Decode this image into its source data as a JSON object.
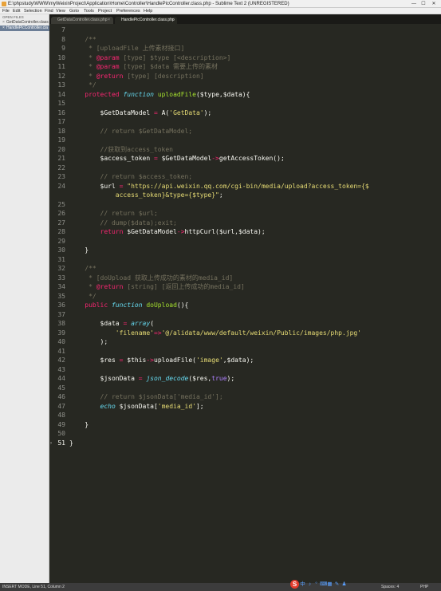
{
  "window": {
    "title": "E:\\phpstudy\\WWW\\myWeixinProject\\Application\\Home\\Controller\\HandlePicController.class.php - Sublime Text 2 (UNREGISTERED)",
    "minimize": "—",
    "maximize": "☐",
    "close": "✕"
  },
  "menu": [
    "File",
    "Edit",
    "Selection",
    "Find",
    "View",
    "Goto",
    "Tools",
    "Project",
    "Preferences",
    "Help"
  ],
  "sidebar": {
    "header": "OPEN FILES",
    "files": [
      {
        "name": "GetDataController.class",
        "active": false
      },
      {
        "name": "HandlePicController.cla",
        "active": true
      }
    ],
    "close_glyph": "×"
  },
  "tabs": [
    {
      "label": "GetDataController.class.php",
      "active": false
    },
    {
      "label": "HandlePicController.class.php",
      "active": true
    }
  ],
  "tab_close_glyph": "×",
  "code": [
    {
      "n": "7",
      "t": []
    },
    {
      "n": "8",
      "t": [
        [
          "    ",
          ""
        ],
        [
          "/**",
          "c-com"
        ]
      ]
    },
    {
      "n": "9",
      "t": [
        [
          "     * [uploadFile 上传素材接口]",
          "c-com"
        ]
      ]
    },
    {
      "n": "10",
      "t": [
        [
          "     * ",
          "c-com"
        ],
        [
          "@param",
          "c-doctag"
        ],
        [
          " [type] $type [<description>]",
          "c-com"
        ]
      ]
    },
    {
      "n": "11",
      "t": [
        [
          "     * ",
          "c-com"
        ],
        [
          "@param",
          "c-doctag"
        ],
        [
          " [type] $data 需要上传的素材",
          "c-com"
        ]
      ]
    },
    {
      "n": "12",
      "t": [
        [
          "     * ",
          "c-com"
        ],
        [
          "@return",
          "c-doctag"
        ],
        [
          " [type] [description]",
          "c-com"
        ]
      ]
    },
    {
      "n": "13",
      "t": [
        [
          "     */",
          "c-com"
        ]
      ]
    },
    {
      "n": "14",
      "t": [
        [
          "    ",
          ""
        ],
        [
          "protected",
          "c-kw"
        ],
        [
          " ",
          ""
        ],
        [
          "function",
          "c-sto"
        ],
        [
          " ",
          ""
        ],
        [
          "uploadFile",
          "c-fn"
        ],
        [
          "($type,$data){",
          ""
        ]
      ]
    },
    {
      "n": "15",
      "t": []
    },
    {
      "n": "16",
      "t": [
        [
          "        $GetDataModel ",
          ""
        ],
        [
          "=",
          "c-kw"
        ],
        [
          " A(",
          ""
        ],
        [
          "'GetData'",
          "c-str"
        ],
        [
          ");",
          ""
        ]
      ]
    },
    {
      "n": "17",
      "t": []
    },
    {
      "n": "18",
      "t": [
        [
          "        // return $GetDataModel;",
          "c-com"
        ]
      ]
    },
    {
      "n": "19",
      "t": []
    },
    {
      "n": "20",
      "t": [
        [
          "        //获取到access_token",
          "c-com"
        ]
      ]
    },
    {
      "n": "21",
      "t": [
        [
          "        $access_token ",
          ""
        ],
        [
          "=",
          "c-kw"
        ],
        [
          " $GetDataModel",
          ""
        ],
        [
          "->",
          "c-kw"
        ],
        [
          "getAccessToken();",
          ""
        ]
      ]
    },
    {
      "n": "22",
      "t": []
    },
    {
      "n": "23",
      "t": [
        [
          "        // return $access_token;",
          "c-com"
        ]
      ]
    },
    {
      "n": "24",
      "t": [
        [
          "        $url ",
          ""
        ],
        [
          "=",
          "c-kw"
        ],
        [
          " ",
          ""
        ],
        [
          "\"https://api.weixin.qq.com/cgi-bin/media/upload?access_token={$",
          "c-str"
        ]
      ]
    },
    {
      "n": "",
      "t": [
        [
          "            access_token}&type={$type}\"",
          "c-str"
        ],
        [
          ";",
          ""
        ]
      ]
    },
    {
      "n": "25",
      "t": []
    },
    {
      "n": "26",
      "t": [
        [
          "        // return $url;",
          "c-com"
        ]
      ]
    },
    {
      "n": "27",
      "t": [
        [
          "        // dump($data);exit;",
          "c-com"
        ]
      ]
    },
    {
      "n": "28",
      "t": [
        [
          "        ",
          ""
        ],
        [
          "return",
          "c-kw"
        ],
        [
          " $GetDataModel",
          ""
        ],
        [
          "->",
          "c-kw"
        ],
        [
          "httpCurl($url,$data);",
          ""
        ]
      ]
    },
    {
      "n": "29",
      "t": []
    },
    {
      "n": "30",
      "t": [
        [
          "    }",
          ""
        ]
      ]
    },
    {
      "n": "31",
      "t": []
    },
    {
      "n": "32",
      "t": [
        [
          "    ",
          ""
        ],
        [
          "/**",
          "c-com"
        ]
      ]
    },
    {
      "n": "33",
      "t": [
        [
          "     * [doUpload 获取上传成功的素材的media_id]",
          "c-com"
        ]
      ]
    },
    {
      "n": "34",
      "t": [
        [
          "     * ",
          "c-com"
        ],
        [
          "@return",
          "c-doctag"
        ],
        [
          " [string] [返回上传成功的media_id]",
          "c-com"
        ]
      ]
    },
    {
      "n": "35",
      "t": [
        [
          "     */",
          "c-com"
        ]
      ]
    },
    {
      "n": "36",
      "t": [
        [
          "    ",
          ""
        ],
        [
          "public",
          "c-kw"
        ],
        [
          " ",
          ""
        ],
        [
          "function",
          "c-sto"
        ],
        [
          " ",
          ""
        ],
        [
          "doUpload",
          "c-fn"
        ],
        [
          "(){",
          ""
        ]
      ]
    },
    {
      "n": "37",
      "t": []
    },
    {
      "n": "38",
      "t": [
        [
          "        $data ",
          ""
        ],
        [
          "=",
          "c-kw"
        ],
        [
          " ",
          ""
        ],
        [
          "array",
          "c-sto"
        ],
        [
          "(",
          ""
        ]
      ]
    },
    {
      "n": "39",
      "t": [
        [
          "            ",
          ""
        ],
        [
          "'filename'",
          "c-str"
        ],
        [
          "=>",
          "c-kw"
        ],
        [
          "'@/alidata/www/default/weixin/Public/images/php.jpg'",
          "c-str"
        ]
      ]
    },
    {
      "n": "40",
      "t": [
        [
          "        );",
          ""
        ]
      ]
    },
    {
      "n": "41",
      "t": []
    },
    {
      "n": "42",
      "t": [
        [
          "        $res ",
          ""
        ],
        [
          "=",
          "c-kw"
        ],
        [
          " $this",
          ""
        ],
        [
          "->",
          "c-kw"
        ],
        [
          "uploadFile(",
          ""
        ],
        [
          "'image'",
          "c-str"
        ],
        [
          ",$data);",
          ""
        ]
      ]
    },
    {
      "n": "43",
      "t": []
    },
    {
      "n": "44",
      "t": [
        [
          "        $jsonData ",
          ""
        ],
        [
          "=",
          "c-kw"
        ],
        [
          " ",
          ""
        ],
        [
          "json_decode",
          "c-sto"
        ],
        [
          "($res,",
          ""
        ],
        [
          "true",
          "c-const"
        ],
        [
          ");",
          ""
        ]
      ]
    },
    {
      "n": "45",
      "t": []
    },
    {
      "n": "46",
      "t": [
        [
          "        // return $jsonData['media_id'];",
          "c-com"
        ]
      ]
    },
    {
      "n": "47",
      "t": [
        [
          "        ",
          ""
        ],
        [
          "echo",
          "c-sto"
        ],
        [
          " $jsonData[",
          ""
        ],
        [
          "'media_id'",
          "c-str"
        ],
        [
          "];",
          ""
        ]
      ]
    },
    {
      "n": "48",
      "t": []
    },
    {
      "n": "49",
      "t": [
        [
          "    }",
          ""
        ]
      ]
    },
    {
      "n": "50",
      "t": []
    },
    {
      "n": "51",
      "t": [
        [
          "}",
          ""
        ]
      ],
      "cur": true
    }
  ],
  "status": {
    "left": "INSERT MODE, Line 51, Column 2",
    "spaces": "Spaces: 4",
    "syntax": "PHP"
  },
  "tray": {
    "ime_logo": "S",
    "icons": [
      "中",
      "♪",
      "°",
      "⌨",
      "▦",
      "✎",
      "♟"
    ]
  },
  "colors": {
    "editor_bg": "#272822",
    "comment": "#75715e",
    "keyword": "#f92672",
    "string": "#e6db74",
    "function": "#a6e22e",
    "storage": "#66d9ef",
    "constant": "#ae81ff",
    "active_file_bg": "#6c7e96"
  }
}
